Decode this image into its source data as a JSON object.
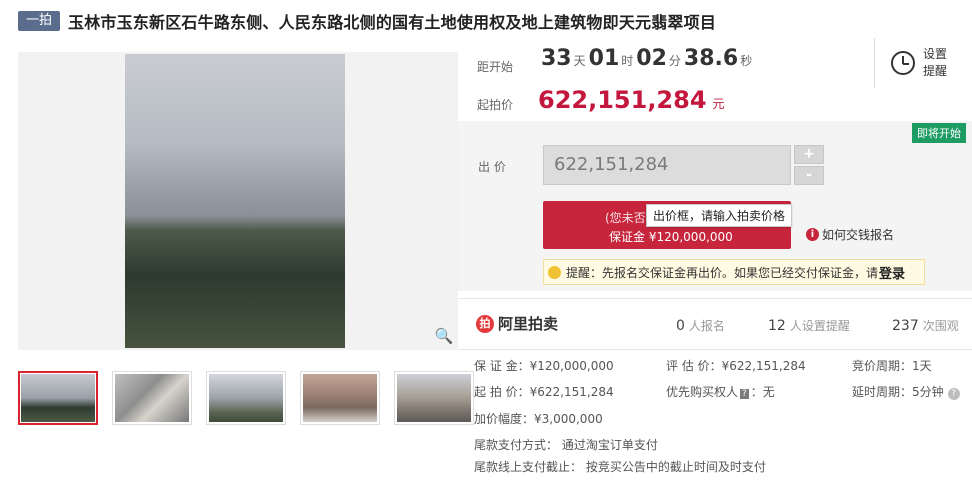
{
  "header": {
    "round_badge": "一拍",
    "title": "玉林市玉东新区石牛路东侧、人民东路北侧的国有土地使用权及地上建筑物即天元翡翠项目"
  },
  "countdown": {
    "label": "距开始",
    "days": "33",
    "days_unit": "天",
    "hours": "01",
    "hours_unit": "时",
    "minutes": "02",
    "minutes_unit": "分",
    "seconds": "38.6",
    "seconds_unit": "秒"
  },
  "reminder": {
    "label": "设置提醒"
  },
  "start_price": {
    "label": "起拍价",
    "value": "622,151,284",
    "unit": "元"
  },
  "bid": {
    "badge": "即将开始",
    "label": "出 价",
    "value": "622,151,284",
    "plus": "+",
    "minus": "-",
    "register_label": "(您未否",
    "deposit_label": "保证金 ¥120,000,000",
    "tooltip": "出价框，请输入拍卖价格",
    "howto": "如何交钱报名",
    "tip_text": "提醒：先报名交保证金再出价。如果您已经交付保证金，请",
    "tip_link": "登录"
  },
  "stats": {
    "brand": "阿里拍卖",
    "signups": "0",
    "signups_label": "人报名",
    "reminders": "12",
    "reminders_label": "人设置提醒",
    "views": "237",
    "views_label": "次围观"
  },
  "info": {
    "deposit": "保 证 金：¥120,000,000",
    "appraisal": "评 估 价：¥622,151,284",
    "cycle": "竞价周期：1天",
    "start": "起 拍 价：¥622,151,284",
    "priority_prefix": "优先购买权人",
    "priority_tag": "?",
    "priority_suffix": "：无",
    "delay": "延时周期：5分钟",
    "increment": "加价幅度：¥3,000,000",
    "payment": "尾款支付方式： 通过淘宝订单支付",
    "deadline": "尾款线上支付截止： 按竞买公告中的截止时间及时支付"
  }
}
